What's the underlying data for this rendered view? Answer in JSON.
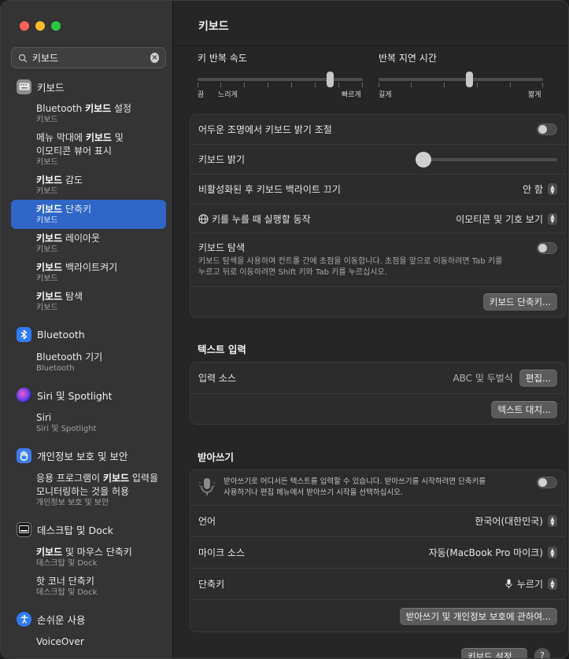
{
  "window": {
    "title": "키보드"
  },
  "colors": {
    "accent": "#2f66c7",
    "close": "#ff5f57",
    "minimize": "#febc2e",
    "zoom": "#28c840"
  },
  "search": {
    "value": "키보드"
  },
  "sidebar": {
    "keyboard_section": "키보드",
    "keyboard_items": [
      {
        "pre": "Bluetooth ",
        "bold": "키보드",
        "post": " 설정",
        "sub": "키보드"
      },
      {
        "pre": "메뉴 막대에 ",
        "bold": "키보드",
        "post": " 및",
        "line2": "이모티콘 뷰어 표시",
        "sub": "키보드"
      },
      {
        "pre": "",
        "bold": "키보드",
        "post": " 감도",
        "sub": "키보드"
      },
      {
        "pre": "",
        "bold": "키보드",
        "post": " 단축키",
        "sub": "키보드"
      },
      {
        "pre": "",
        "bold": "키보드",
        "post": " 레이아웃",
        "sub": "키보드"
      },
      {
        "pre": "",
        "bold": "키보드",
        "post": " 백라이트켜기",
        "sub": "키보드"
      },
      {
        "pre": "",
        "bold": "키보드",
        "post": " 탐색",
        "sub": "키보드"
      }
    ],
    "bluetooth_section": "Bluetooth",
    "bluetooth_item": {
      "title": "Bluetooth 기기",
      "sub": "Bluetooth"
    },
    "siri_section": "Siri 및 Spotlight",
    "siri_item": {
      "title": "Siri",
      "sub": "Siri 및 Spotlight"
    },
    "privacy_section": "개인정보 보호 및 보안",
    "privacy_item": {
      "pre": "응용 프로그램이 ",
      "bold": "키보드",
      "post": " 입력을",
      "line2": "모니터링하는 것을 허용",
      "sub": "개인정보 보호 및 보안"
    },
    "desktop_section": "데스크탑 및 Dock",
    "desktop_items": [
      {
        "pre": "",
        "bold": "키보드",
        "post": " 및 마우스 단축키",
        "sub": "데스크탑 및 Dock"
      },
      {
        "title": "핫 코너 단축키",
        "sub": "데스크탑 및 Dock"
      }
    ],
    "accessibility_section": "손쉬운 사용",
    "accessibility_item": "VoiceOver"
  },
  "main": {
    "key_repeat": {
      "label": "키 반복 속도",
      "left": "끔",
      "mid": "느리게",
      "right": "빠르게",
      "value": 0.8
    },
    "repeat_delay": {
      "label": "반복 지연 시간",
      "left": "길게",
      "right": "짧게",
      "value": 0.55
    },
    "auto_brightness": "어두운 조명에서 키보드 밝기 조절",
    "brightness": "키보드 밝기",
    "brightness_value": 0.0,
    "backlight_off": {
      "label": "비활성화된 후 키보드 백라이트 끄기",
      "value": "안 함"
    },
    "globe_action": {
      "label": "키를 누를 때 실행할 동작",
      "value": "이모티콘 및 기호 보기"
    },
    "keyboard_nav": {
      "label": "키보드 탐색",
      "desc1": "키보드 탐색을 사용하여 컨트롤 간에 초점을 이동합니다. 초점을 앞으로 이동하려면 Tab 키를",
      "desc2": "누르고 뒤로 이동하려면 Shift 키와 Tab 키를 누르십시오."
    },
    "shortcuts_button": "키보드 단축키...",
    "text_input_title": "텍스트 입력",
    "input_sources": {
      "label": "입력 소스",
      "value": "ABC 및 두벌식",
      "edit": "편집..."
    },
    "text_replace_button": "텍스트 대치...",
    "dictation_title": "받아쓰기",
    "dictation_desc1": "받아쓰기로 어디서든 텍스트를 입력할 수 있습니다. 받아쓰기를 시작하려면 단축키를",
    "dictation_desc2": "사용하거나 편집 메뉴에서 받아쓰기 시작을 선택하십시오.",
    "language": {
      "label": "언어",
      "value": "한국어(대한민국)"
    },
    "mic_source": {
      "label": "마이크 소스",
      "value": "자동(MacBook Pro 마이크)"
    },
    "shortcut": {
      "label": "단축키",
      "value": "누르기"
    },
    "about_dictation_button": "받아쓰기 및 개인정보 보호에 관하여...",
    "keyboard_setup_button": "키보드 설정...",
    "help": "?"
  }
}
